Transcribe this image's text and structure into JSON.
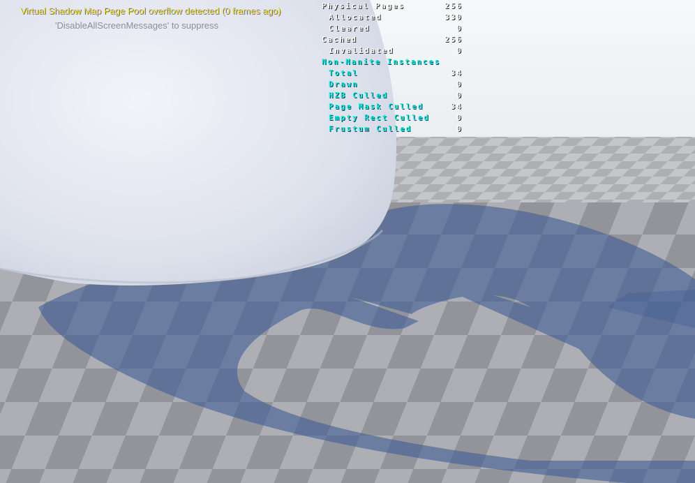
{
  "messages": {
    "warning": "Virtual Shadow Map Page Pool overflow detected (0 frames ago)",
    "suppress_hint": "'DisableAllScreenMessages' to suppress"
  },
  "stats": {
    "physical_pages": {
      "label": "Physical Pages",
      "value": "256"
    },
    "allocated": {
      "label": "Allocated",
      "value": "330"
    },
    "cleared": {
      "label": "Cleared",
      "value": "0"
    },
    "cached": {
      "label": "Cached",
      "value": "256"
    },
    "invalidated": {
      "label": "Invalidated",
      "value": "0"
    },
    "non_nanite_header": {
      "label": "Non-Nanite Instances"
    },
    "total": {
      "label": "Total",
      "value": "34"
    },
    "drawn": {
      "label": "Drawn",
      "value": "0"
    },
    "hzb_culled": {
      "label": "HZB Culled",
      "value": "0"
    },
    "page_mask_culled": {
      "label": "Page Mask Culled",
      "value": "34"
    },
    "empty_rect_culled": {
      "label": "Empty Rect Culled",
      "value": "0"
    },
    "frustum_culled": {
      "label": "Frustum Culled",
      "value": "0"
    }
  },
  "colors": {
    "warning_text": "#f2e23a",
    "hint_text": "#8a8f97",
    "stat_white": "#ffffff",
    "stat_cyan": "#18f0f0",
    "sky": "#f3f4f7",
    "floor_light": "#aeb0b4",
    "floor_dark": "#8e9095",
    "shadow_tint": "#3d5a93",
    "sphere": "#e6e9f2"
  }
}
